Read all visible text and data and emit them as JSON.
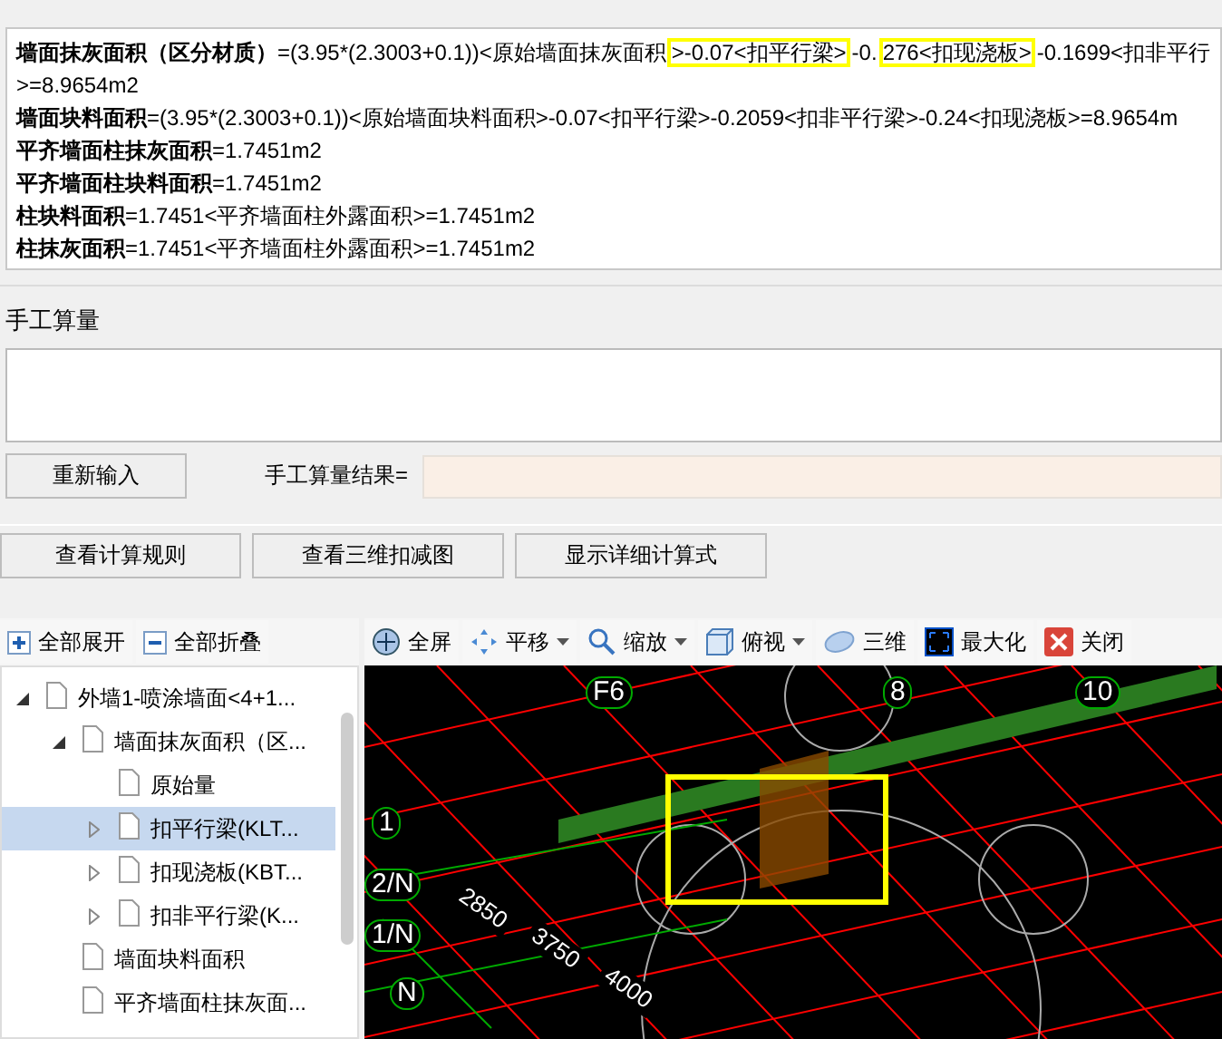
{
  "calc_lines": [
    {
      "term": "墙面抹灰面积（区分材质）",
      "segments": [
        {
          "text": "=(3.95*(2.3003+0.1))<原始墙面抹灰面积",
          "highlighted": false
        },
        {
          "text": ">-0.07<扣平行梁>",
          "highlighted": true
        },
        {
          "text": "-0.",
          "highlighted": false
        },
        {
          "text": "276<扣现浇板>",
          "highlighted": true
        },
        {
          "text": "-0.1699<扣非平行",
          "highlighted": false
        }
      ]
    },
    {
      "segments": [
        {
          "text": ">=8.9654m2",
          "highlighted": false
        }
      ]
    },
    {
      "term": "墙面块料面积",
      "segments": [
        {
          "text": "=(3.95*(2.3003+0.1))<原始墙面块料面积>-0.07<扣平行梁>-0.2059<扣非平行梁>-0.24<扣现浇板>=8.9654m",
          "highlighted": false
        }
      ]
    },
    {
      "term": "平齐墙面柱抹灰面积",
      "segments": [
        {
          "text": "=1.7451m2",
          "highlighted": false
        }
      ]
    },
    {
      "term": "平齐墙面柱块料面积",
      "segments": [
        {
          "text": "=1.7451m2",
          "highlighted": false
        }
      ]
    },
    {
      "term": "柱块料面积",
      "segments": [
        {
          "text": "=1.7451<平齐墙面柱外露面积>=1.7451m2",
          "highlighted": false
        }
      ]
    },
    {
      "term": "柱抹灰面积",
      "segments": [
        {
          "text": "=1.7451<平齐墙面柱外露面积>=1.7451m2",
          "highlighted": false
        }
      ]
    }
  ],
  "manual": {
    "title": "手工算量",
    "reenter_button": "重新输入",
    "result_label": "手工算量结果="
  },
  "buttons": [
    "查看计算规则",
    "查看三维扣减图",
    "显示详细计算式"
  ],
  "tree_toolbar": [
    "全部展开",
    "全部折叠"
  ],
  "tree": [
    {
      "label": "外墙1-喷涂墙面<4+1...",
      "expanded": true,
      "selected": false,
      "children": [
        {
          "label": "墙面抹灰面积（区...",
          "expanded": true,
          "selected": false,
          "children": [
            {
              "label": "原始量",
              "selected": false
            },
            {
              "label": "扣平行梁(KLT...",
              "expanded": false,
              "selected": true
            },
            {
              "label": "扣现浇板(KBT...",
              "expanded": false,
              "selected": false
            },
            {
              "label": "扣非平行梁(K...",
              "expanded": false,
              "selected": false
            }
          ]
        },
        {
          "label": "墙面块料面积",
          "selected": false
        },
        {
          "label": "平齐墙面柱抹灰面...",
          "selected": false
        }
      ]
    }
  ],
  "view_toolbar": [
    {
      "kind": "fullscreen",
      "label": "全屏",
      "dropdown": false
    },
    {
      "kind": "pan",
      "label": "平移",
      "dropdown": true
    },
    {
      "kind": "zoom",
      "label": "缩放",
      "dropdown": true
    },
    {
      "kind": "top",
      "label": "俯视",
      "dropdown": true
    },
    {
      "kind": "orbit",
      "label": "三维",
      "dropdown": false
    },
    {
      "kind": "maximize",
      "label": "最大化",
      "dropdown": false
    },
    {
      "kind": "close",
      "label": "关闭",
      "dropdown": false
    }
  ],
  "viewport": {
    "labels": [
      {
        "text": "F6",
        "kind": "axis"
      },
      {
        "text": "8",
        "kind": "axis"
      },
      {
        "text": "10",
        "kind": "axis"
      },
      {
        "text": "1",
        "kind": "axis"
      },
      {
        "text": "2/N",
        "kind": "axis"
      },
      {
        "text": "1/N",
        "kind": "axis"
      },
      {
        "text": "N",
        "kind": "axis"
      },
      {
        "text": "2850",
        "kind": "dim"
      },
      {
        "text": "3750",
        "kind": "dim"
      },
      {
        "text": "4000",
        "kind": "dim"
      }
    ]
  }
}
